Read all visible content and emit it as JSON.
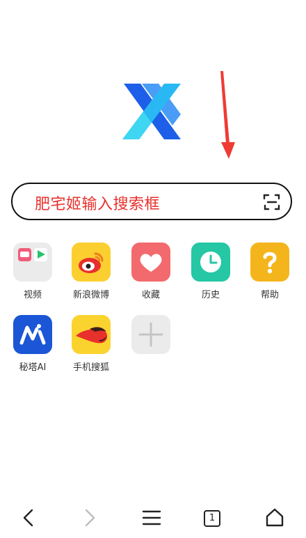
{
  "search": {
    "placeholder": "肥宅姬输入搜索框"
  },
  "shortcuts": [
    {
      "label": "视频",
      "icon": "video-folder-icon"
    },
    {
      "label": "新浪微博",
      "icon": "weibo-icon"
    },
    {
      "label": "收藏",
      "icon": "heart-icon"
    },
    {
      "label": "历史",
      "icon": "clock-icon"
    },
    {
      "label": "帮助",
      "icon": "question-icon"
    },
    {
      "label": "秘塔AI",
      "icon": "metaso-icon"
    },
    {
      "label": "手机搜狐",
      "icon": "sohu-fox-icon"
    },
    {
      "label": "",
      "icon": "add-icon"
    }
  ],
  "nav": {
    "tab_count": "1"
  },
  "colors": {
    "accent_red": "#e8302c",
    "logo_blue": "#1a6ef5",
    "logo_cyan": "#2fd0f0"
  }
}
